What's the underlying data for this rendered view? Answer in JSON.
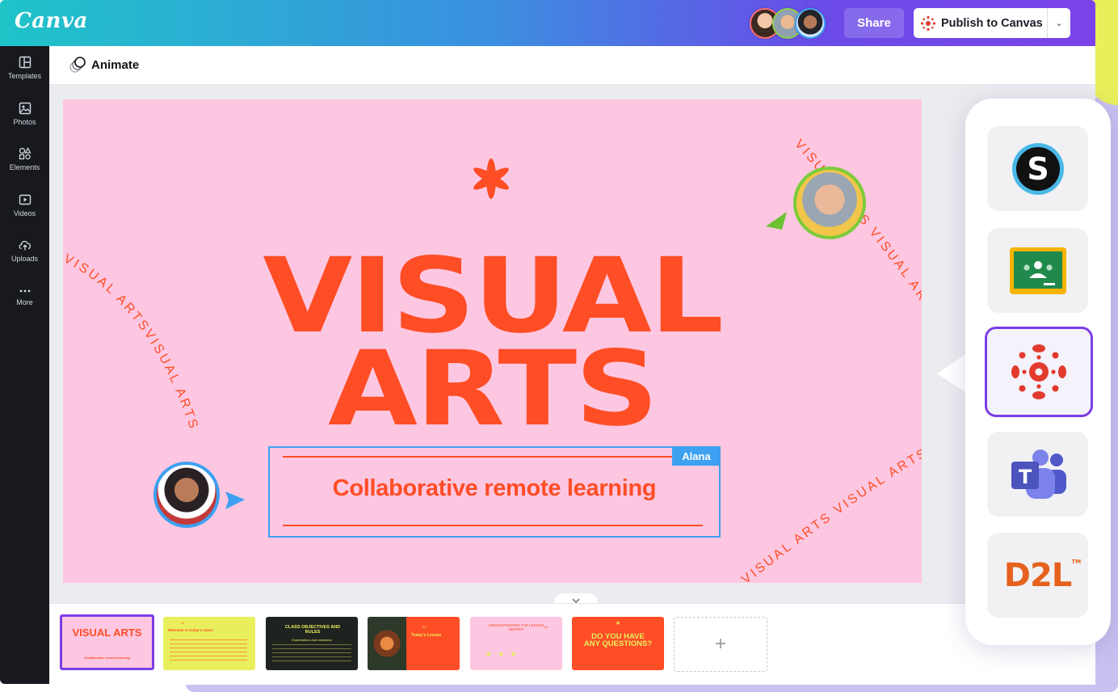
{
  "app": {
    "logo": "Canva",
    "colors": {
      "accent": "#7c3ee6",
      "brand_teal": "#1fc4c9",
      "slide_bg": "#fdc7e1",
      "slide_text": "#ff4d25",
      "selection": "#3da0f0"
    }
  },
  "header": {
    "collaborators": [
      "collaborator-1",
      "collaborator-2",
      "collaborator-3"
    ],
    "share_label": "Share",
    "publish_label": "Publish to Canvas"
  },
  "sidebar": {
    "items": [
      {
        "label": "Templates",
        "icon": "templates-icon"
      },
      {
        "label": "Photos",
        "icon": "photos-icon"
      },
      {
        "label": "Elements",
        "icon": "elements-icon"
      },
      {
        "label": "Videos",
        "icon": "videos-icon"
      },
      {
        "label": "Uploads",
        "icon": "uploads-icon"
      },
      {
        "label": "More",
        "icon": "more-icon"
      }
    ]
  },
  "toolbar": {
    "animate_label": "Animate"
  },
  "slide": {
    "title_line1": "VISUAL",
    "title_line2": "ARTS",
    "subtitle": "Collaborative remote learning",
    "selection_user": "Alana",
    "curved_text_left": "VISUAL ARTSVISUAL ARTS",
    "curved_text_right": "VISUAL ARTS VISUAL ARTS VISUAL ARTS VISUAL ARTS VISUAL ARTS V"
  },
  "filmstrip": {
    "slides": [
      {
        "title": "VISUAL ARTS",
        "sub": "Collaborative remote learning"
      },
      {
        "title": "Welcome to today's class!",
        "num": "01"
      },
      {
        "title": "CLASS OBJECTIVES AND RULES",
        "sub": "Expectations and outcomes"
      },
      {
        "title": "Today's Lesson",
        "num": "03"
      },
      {
        "title": "UNDERSTANDING THE LESSON DEEPER",
        "num": "04"
      },
      {
        "title": "DO YOU HAVE ANY QUESTIONS?"
      }
    ],
    "add_label": "+"
  },
  "lms_panel": {
    "items": [
      "schoology-icon",
      "google-classroom-icon",
      "canvas-icon",
      "microsoft-teams-icon",
      "d2l-logo"
    ],
    "d2l_text": "D2L",
    "d2l_tm": "TM"
  }
}
